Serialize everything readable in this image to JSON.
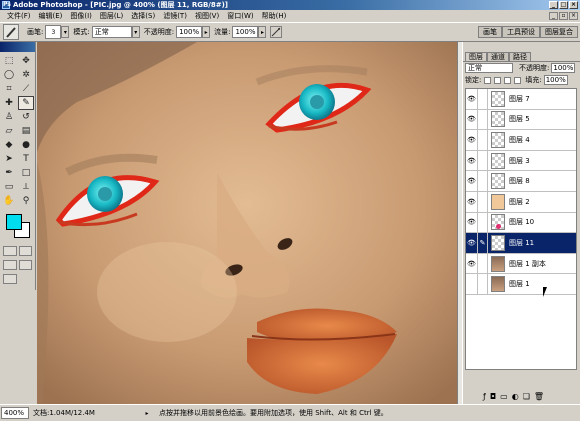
{
  "window": {
    "title": "Adobe Photoshop - [PIC.jpg @ 400% (图层 11, RGB/8#)]"
  },
  "menu": [
    "文件(F)",
    "编辑(E)",
    "图像(I)",
    "图层(L)",
    "选择(S)",
    "滤镜(T)",
    "视图(V)",
    "窗口(W)",
    "帮助(H)"
  ],
  "options": {
    "brush_label": "画笔:",
    "brush_size": "3",
    "mode_label": "模式:",
    "mode_value": "正常",
    "opacity_label": "不透明度:",
    "opacity_value": "100%",
    "flow_label": "流量:",
    "flow_value": "100%"
  },
  "palette_well": [
    "画笔",
    "工具预设",
    "图层复合"
  ],
  "layers_panel": {
    "tabs": [
      "图层",
      "通道",
      "路径"
    ],
    "blend_mode": "正常",
    "opacity_label": "不透明度:",
    "opacity_value": "100%",
    "lock_label": "锁定:",
    "fill_label": "填充:",
    "fill_value": "100%",
    "layers": [
      {
        "name": "图层 7",
        "visible": true,
        "thumb": "transparent"
      },
      {
        "name": "图层 5",
        "visible": true,
        "thumb": "transparent"
      },
      {
        "name": "图层 4",
        "visible": true,
        "thumb": "transparent"
      },
      {
        "name": "图层 3",
        "visible": true,
        "thumb": "transparent"
      },
      {
        "name": "图层 8",
        "visible": true,
        "thumb": "transparent"
      },
      {
        "name": "图层 2",
        "visible": true,
        "thumb": "peach"
      },
      {
        "name": "图层 10",
        "visible": true,
        "thumb": "dot"
      },
      {
        "name": "图层 11",
        "visible": true,
        "thumb": "transparent",
        "selected": true
      },
      {
        "name": "图层 1 副本",
        "visible": true,
        "thumb": "photo"
      },
      {
        "name": "图层 1",
        "visible": false,
        "thumb": "photo"
      }
    ]
  },
  "toolbox": {
    "foreground_color": "#00ddee",
    "background_color": "#ffffff"
  },
  "status": {
    "zoom": "400%",
    "doc_info": "文档:1.04M/12.4M",
    "hint": "点按并拖移以用前景色绘画。要用附加选项，使用 Shift、Alt 和 Ctrl 键。"
  }
}
